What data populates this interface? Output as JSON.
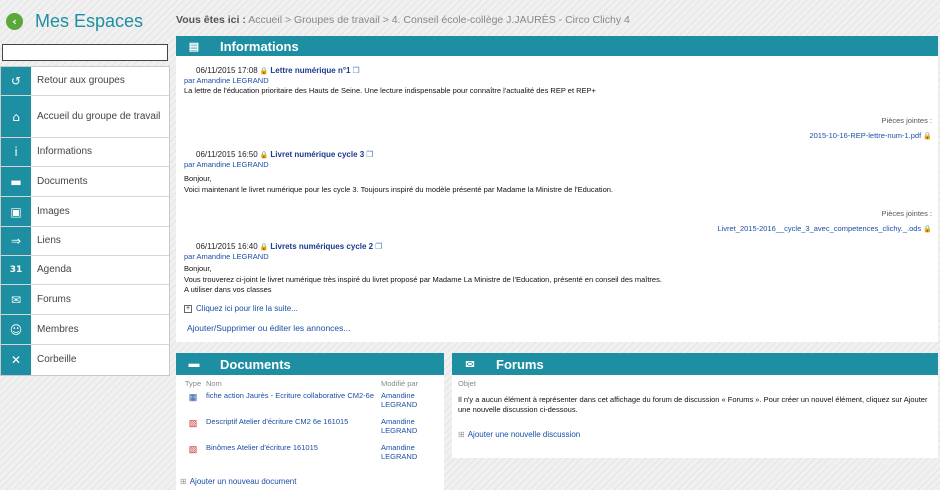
{
  "sidebar": {
    "title": "Mes Espaces",
    "items": [
      {
        "label": "Retour aux groupes",
        "icon": "back-arrow-icon",
        "glyph": "↺"
      },
      {
        "label": "Accueil du groupe de travail",
        "icon": "cart-icon",
        "glyph": "⌂"
      },
      {
        "label": "Informations",
        "icon": "info-icon",
        "glyph": "i"
      },
      {
        "label": "Documents",
        "icon": "folder-icon",
        "glyph": "▬"
      },
      {
        "label": "Images",
        "icon": "image-icon",
        "glyph": "▣"
      },
      {
        "label": "Liens",
        "icon": "link-icon",
        "glyph": "⇒"
      },
      {
        "label": "Agenda",
        "icon": "calendar-icon",
        "glyph": "31"
      },
      {
        "label": "Forums",
        "icon": "chat-icon",
        "glyph": "✉"
      },
      {
        "label": "Membres",
        "icon": "members-icon",
        "glyph": "☺"
      },
      {
        "label": "Corbeille",
        "icon": "trash-icon",
        "glyph": "✕"
      }
    ]
  },
  "breadcrumb": {
    "label": "Vous êtes ici :",
    "path": "Accueil > Groupes de travail > 4. Conseil école-collège J.JAURÈS - Circo Clichy 4"
  },
  "info": {
    "title": "Informations",
    "announcements": [
      {
        "date": "06/11/2015 17:08",
        "title": "Lettre numérique n°1",
        "author": "par Amandine LEGRAND",
        "body": "La lettre de l'éducation prioritaire des Hauts de Seine. Une lecture indispensable pour connaître l'actualité des REP et REP+"
      },
      {
        "date": "06/11/2015 16:50",
        "title": "Livret numérique cycle 3",
        "author": "par Amandine LEGRAND",
        "body1": "Bonjour,",
        "body2": "Voici maintenant le livret numérique pour les cycle 3. Toujours inspiré du modèle présenté par Madame la Ministre de l'Education."
      },
      {
        "date": "06/11/2015 16:40",
        "title": "Livrets numériques cycle 2",
        "author": "par Amandine LEGRAND",
        "body1": "Bonjour,",
        "body2": "Vous trouverez ci-joint le livret numérique très inspiré du livret proposé par Madame La Ministre de l'Education, présenté en conseil des maîtres.",
        "body3": "A utiliser dans vos classes"
      }
    ],
    "attachments_label": "Pièces jointes :",
    "attachment1": "2015-10-16-REP-lettre-num-1.pdf",
    "attachment2": "Livret_2015-2016__cycle_3_avec_competences_clichy._.ods",
    "read_more": "Cliquez ici pour lire la suite...",
    "manage_link": "Ajouter/Supprimer ou éditer les annonces..."
  },
  "documents": {
    "title": "Documents",
    "columns": {
      "type": "Type",
      "name": "Nom",
      "modified_by": "Modifié par"
    },
    "rows": [
      {
        "name": "fiche action Jaurès - Ecriture collaborative CM2-6e",
        "by": "Amandine LEGRAND",
        "icon": "word-document-icon"
      },
      {
        "name": "Descriptif Atelier d'écriture CM2 6e 161015",
        "by": "Amandine LEGRAND",
        "icon": "pdf-icon"
      },
      {
        "name": "Binômes Atelier d'écriture 161015",
        "by": "Amandine LEGRAND",
        "icon": "pdf-icon"
      }
    ],
    "add": "Ajouter un nouveau document"
  },
  "forums": {
    "title": "Forums",
    "column": "Objet",
    "message": "Il n'y a aucun élément à représenter dans cet affichage du forum de discussion « Forums ». Pour créer un nouvel élément, cliquez sur Ajouter une nouvelle discussion ci-dessous.",
    "add": "Ajouter une nouvelle discussion"
  },
  "colors": {
    "accent": "#1e8ea3",
    "link": "#1a4ea6",
    "back_button": "#5aa83a"
  }
}
